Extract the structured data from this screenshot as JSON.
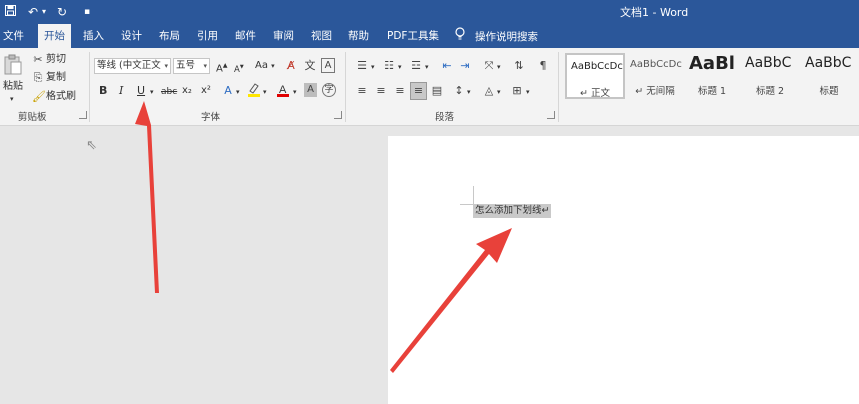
{
  "title_bar": {
    "doc_title": "文档1  -  Word",
    "quick_access": [
      {
        "icon": "save-icon",
        "glyph": "💾"
      },
      {
        "icon": "undo-icon",
        "glyph": "↶"
      },
      {
        "icon": "redo-icon",
        "glyph": "↻"
      },
      {
        "icon": "customize-icon",
        "glyph": "▾"
      }
    ]
  },
  "tabs": {
    "file": "文件",
    "home": "开始",
    "insert": "插入",
    "design": "设计",
    "layout": "布局",
    "references": "引用",
    "mailings": "邮件",
    "review": "审阅",
    "view": "视图",
    "help": "帮助",
    "pdf": "PDF工具集",
    "tell_me": "操作说明搜索"
  },
  "clipboard": {
    "label": "剪贴板",
    "paste": "粘贴",
    "cut": "剪切",
    "copy": "复制",
    "format_painter": "格式刷"
  },
  "font": {
    "label": "字体",
    "font_name": "等线 (中文正文",
    "font_size": "五号",
    "grow": "A",
    "shrink": "A",
    "change_case": "Aa",
    "bold": "B",
    "italic": "I",
    "underline": "U",
    "strike": "abc",
    "subscript": "x₂",
    "superscript": "x²"
  },
  "paragraph": {
    "label": "段落"
  },
  "styles": {
    "items": [
      {
        "sample": "AaBbCcDc",
        "name": "↵ 正文"
      },
      {
        "sample": "AaBbCcDc",
        "name": "↵ 无间隔"
      },
      {
        "sample": "AaBl",
        "name": "标题 1"
      },
      {
        "sample": "AaBbC",
        "name": "标题 2"
      },
      {
        "sample": "AaBbC",
        "name": "标题"
      }
    ]
  },
  "document": {
    "text": "怎么添加下划线↵"
  },
  "colors": {
    "title_bar": "#2b579a",
    "ribbon": "#f3f3f3",
    "arrow": "#e8413a",
    "highlight": "#ffe600",
    "font_color": "#e00000"
  }
}
